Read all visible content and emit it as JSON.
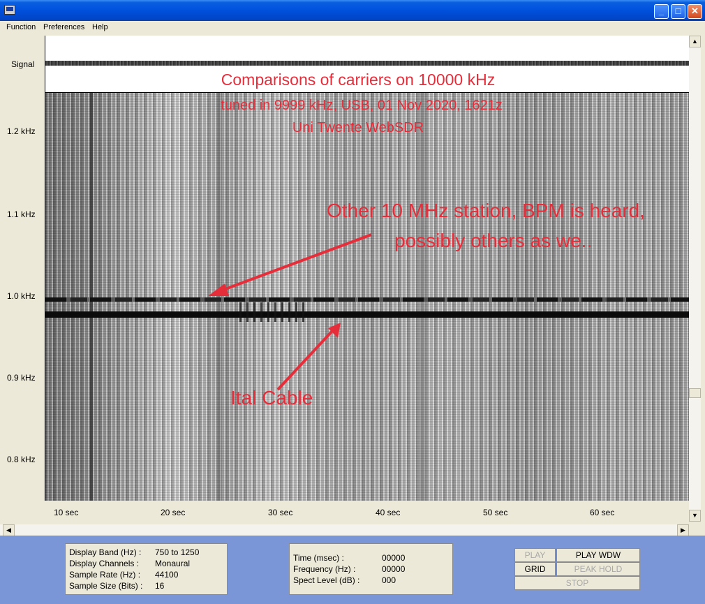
{
  "window": {
    "minimize_glyph": "_",
    "maximize_glyph": "□",
    "close_glyph": "✕"
  },
  "menu": {
    "items": [
      "Function",
      "Preferences",
      "Help"
    ]
  },
  "signal": {
    "label": "Signal"
  },
  "freq_axis": [
    "1.2 kHz",
    "1.1 kHz",
    "1.0 kHz",
    "0.9 kHz",
    "0.8 kHz"
  ],
  "time_axis": [
    "10  sec",
    "20  sec",
    "30  sec",
    "40  sec",
    "50  sec",
    "60  sec"
  ],
  "annotations": {
    "title": "Comparisons of carriers on 10000 kHz",
    "subtitle": "tuned in 9999 kHz, USB, 01 Nov 2020, 1621z",
    "source": "Uni Twente WebSDR",
    "bpm_line1": "Other 10 MHz station, BPM is heard,",
    "bpm_line2": "possibly others as we..",
    "ital": "Ital Cable",
    "color": "#e62e3b"
  },
  "display_info": {
    "band_label": "Display Band (Hz) :",
    "band_value": "750 to 1250",
    "channels_label": "Display Channels :",
    "channels_value": "Monaural",
    "rate_label": "Sample Rate (Hz) :",
    "rate_value": "44100",
    "size_label": "Sample Size (Bits) :",
    "size_value": "16"
  },
  "readout": {
    "time_label": "Time (msec) :",
    "time_value": "00000",
    "freq_label": "Frequency (Hz) :",
    "freq_value": "00000",
    "level_label": "Spect Level (dB) :",
    "level_value": "000"
  },
  "controls": {
    "play": "PLAY",
    "play_wdw": "PLAY WDW",
    "grid": "GRID",
    "peak_hold": "PEAK HOLD",
    "stop": "STOP"
  },
  "colors": {
    "taskbar_blue": "#7b96d6",
    "title_blue": "#0050dc"
  }
}
